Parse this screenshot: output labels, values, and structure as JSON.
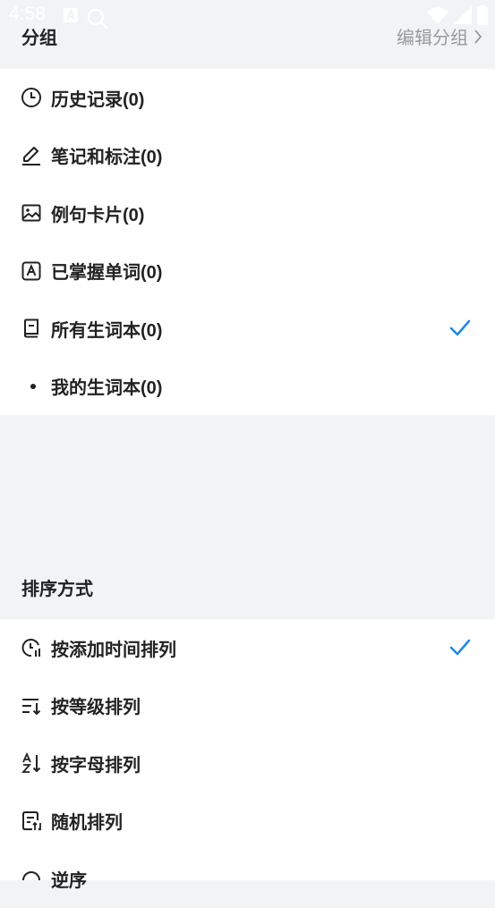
{
  "status_bar": {
    "time": "4:58"
  },
  "group_section": {
    "title": "分组",
    "edit_label": "编辑分组",
    "items": [
      {
        "label": "历史记录(0)",
        "icon": "clock-icon",
        "selected": false
      },
      {
        "label": "笔记和标注(0)",
        "icon": "pen-icon",
        "selected": false
      },
      {
        "label": "例句卡片(0)",
        "icon": "image-card-icon",
        "selected": false
      },
      {
        "label": "已掌握单词(0)",
        "icon": "mastered-a-icon",
        "selected": false
      },
      {
        "label": "所有生词本(0)",
        "icon": "book-icon",
        "selected": true
      },
      {
        "label": "我的生词本(0)",
        "icon": "dot-icon",
        "selected": false
      }
    ]
  },
  "sort_section": {
    "title": "排序方式",
    "items": [
      {
        "label": "按添加时间排列",
        "icon": "time-sort-icon",
        "selected": true
      },
      {
        "label": "按等级排列",
        "icon": "level-sort-icon",
        "selected": false
      },
      {
        "label": "按字母排列",
        "icon": "alpha-sort-icon",
        "selected": false
      },
      {
        "label": "随机排列",
        "icon": "random-sort-icon",
        "selected": false
      },
      {
        "label": "逆序",
        "icon": "reverse-icon",
        "selected": false
      }
    ]
  },
  "colors": {
    "accent": "#1e88e5",
    "background": "#f2f3f5",
    "card": "#ffffff",
    "muted_text": "#9a9a9a"
  }
}
